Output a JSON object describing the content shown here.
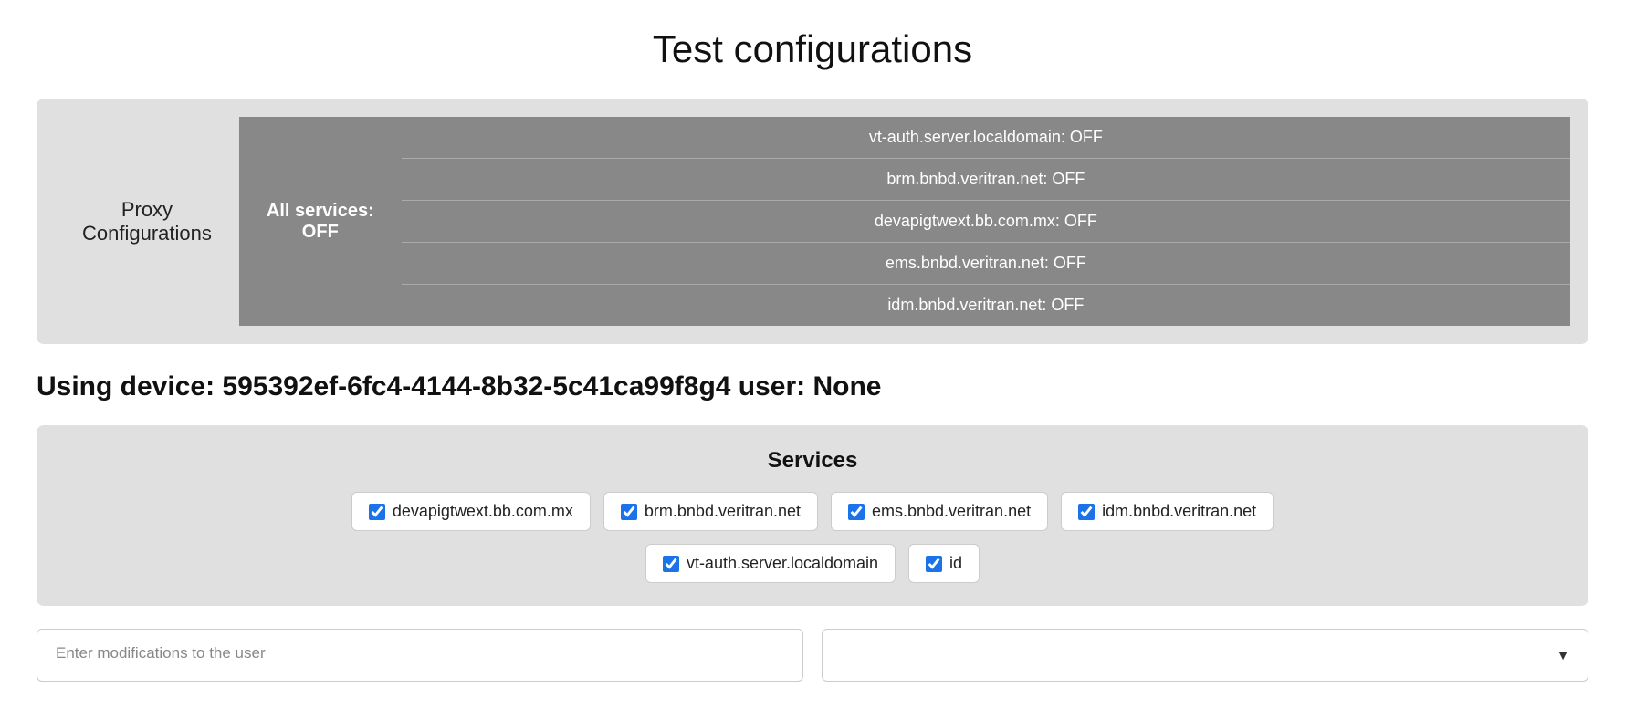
{
  "page": {
    "title": "Test configurations"
  },
  "proxy": {
    "label": "Proxy\nConfigurations",
    "all_services_label": "All services:\nOFF",
    "services": [
      {
        "name": "vt-auth.server.localdomain: OFF"
      },
      {
        "name": "brm.bnbd.veritran.net: OFF"
      },
      {
        "name": "devapigtwext.bb.com.mx: OFF"
      },
      {
        "name": "ems.bnbd.veritran.net: OFF"
      },
      {
        "name": "idm.bnbd.veritran.net: OFF"
      }
    ]
  },
  "device_info": "Using device: 595392ef-6fc4-4144-8b32-5c41ca99f8g4 user: None",
  "services_section": {
    "title": "Services",
    "checkboxes_row1": [
      {
        "id": "cb1",
        "label": "devapigtwext.bb.com.mx",
        "checked": true
      },
      {
        "id": "cb2",
        "label": "brm.bnbd.veritran.net",
        "checked": true
      },
      {
        "id": "cb3",
        "label": "ems.bnbd.veritran.net",
        "checked": true
      },
      {
        "id": "cb4",
        "label": "idm.bnbd.veritran.net",
        "checked": true
      }
    ],
    "checkboxes_row2": [
      {
        "id": "cb5",
        "label": "vt-auth.server.localdomain",
        "checked": true
      },
      {
        "id": "cb6",
        "label": "id",
        "checked": true
      }
    ]
  },
  "bottom": {
    "left_placeholder": "Enter modifications to the user",
    "right_placeholder": ""
  }
}
